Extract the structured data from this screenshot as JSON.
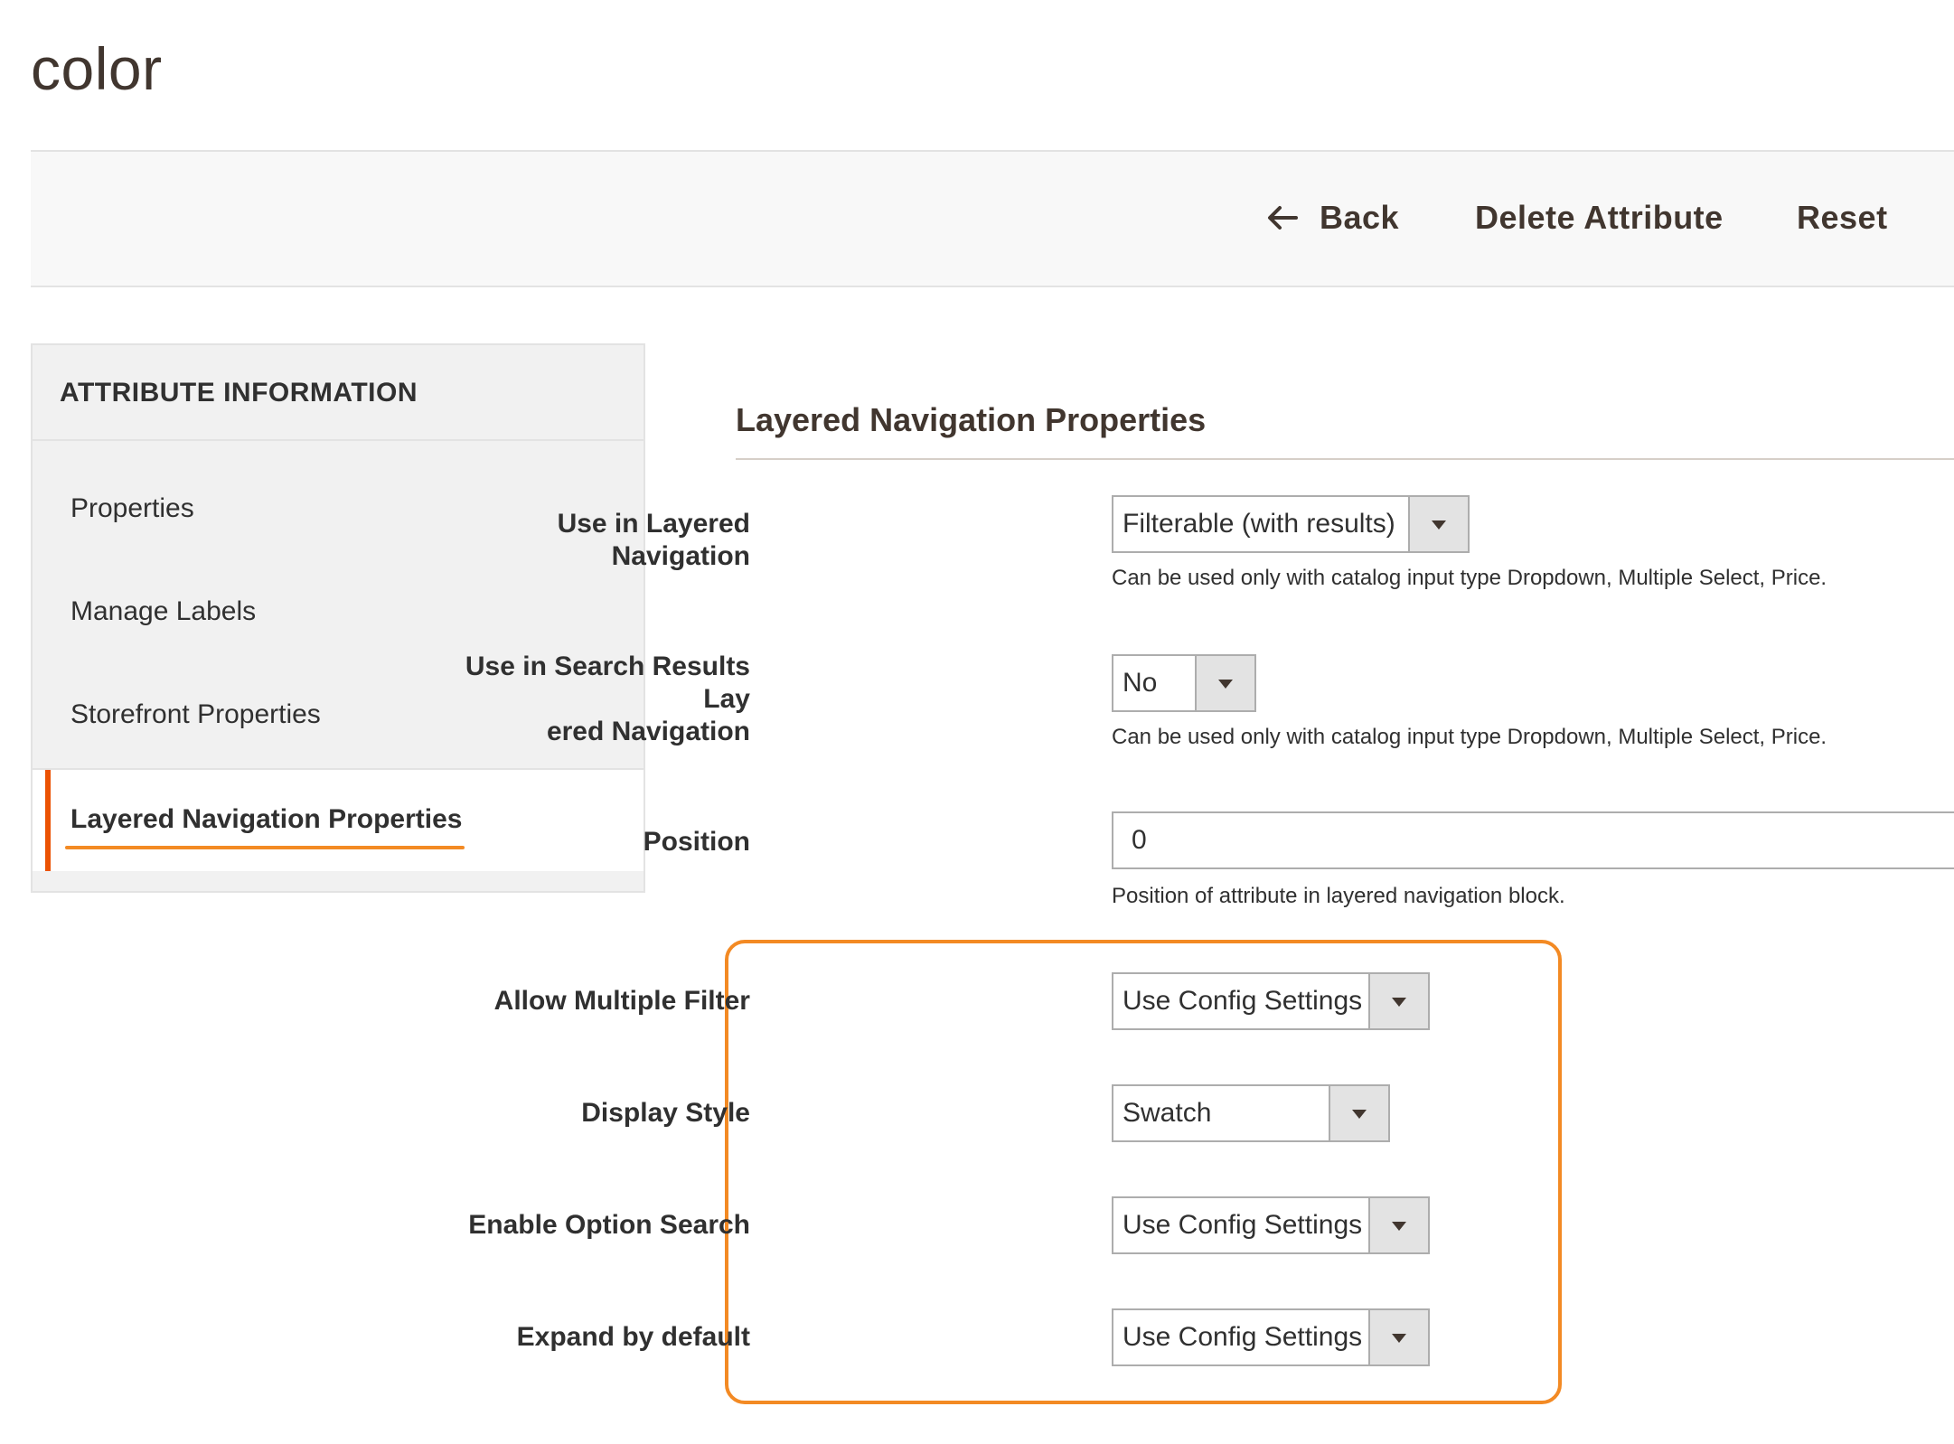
{
  "page": {
    "title": "color"
  },
  "actions": {
    "back": "Back",
    "delete": "Delete Attribute",
    "reset": "Reset"
  },
  "sidebar": {
    "heading": "ATTRIBUTE INFORMATION",
    "items": [
      {
        "label": "Properties",
        "active": false
      },
      {
        "label": "Manage Labels",
        "active": false
      },
      {
        "label": "Storefront Properties",
        "active": false
      },
      {
        "label": "Layered Navigation Properties",
        "active": true
      }
    ]
  },
  "main": {
    "section_title": "Layered Navigation Properties",
    "fields": {
      "use_in_layered_nav": {
        "label": "Use in Layered Navigation",
        "value": "Filterable (with results)",
        "note": "Can be used only with catalog input type Dropdown, Multiple Select, Price."
      },
      "use_in_search": {
        "label_line1": "Use in Search Results Lay",
        "label_line2": "ered Navigation",
        "value": "No",
        "note": "Can be used only with catalog input type Dropdown, Multiple Select, Price."
      },
      "position": {
        "label": "Position",
        "value": "0",
        "note": "Position of attribute in layered navigation block."
      },
      "allow_multiple_filter": {
        "label": "Allow Multiple Filter",
        "value": "Use Config Settings"
      },
      "display_style": {
        "label": "Display Style",
        "value": "Swatch"
      },
      "enable_option_search": {
        "label": "Enable Option Search",
        "value": "Use Config Settings"
      },
      "expand_by_default": {
        "label": "Expand by default",
        "value": "Use Config Settings"
      }
    }
  },
  "colors": {
    "accent": "#eb5202",
    "highlight": "#f38a24",
    "toolbar_bg": "#f8f8f8",
    "sidebar_bg": "#f1f1f1"
  },
  "icons": {
    "back": "arrow-left-icon",
    "dropdown": "caret-down-icon"
  }
}
